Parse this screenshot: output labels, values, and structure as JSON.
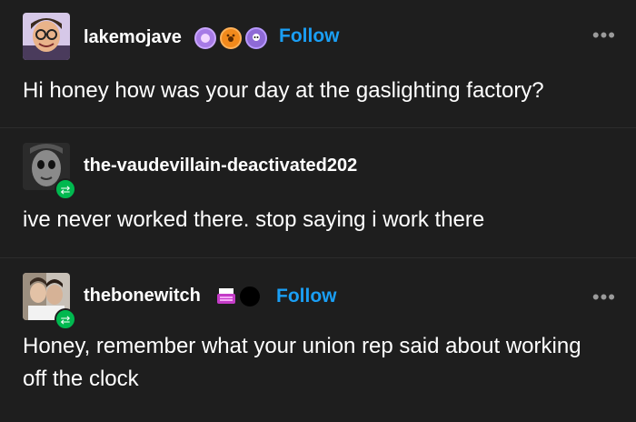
{
  "posts": [
    {
      "username": "lakemojave",
      "follow_label": "Follow",
      "more_label": "•••",
      "text": "Hi honey how was your day at the gaslighting factory?",
      "badges": [
        "blue-hand-badge",
        "orange-paw-badge",
        "purple-skull-badge"
      ]
    },
    {
      "username": "the-vaudevillain-deactivated202",
      "text": "ive never worked there. stop saying i work there",
      "reblog_icon": "reblog-icon"
    },
    {
      "username": "thebonewitch",
      "follow_label": "Follow",
      "more_label": "•••",
      "text": "Honey, remember what your union rep said about working off the clock",
      "badges": [
        "typewriter-badge",
        "black-circle-badge"
      ],
      "reblog_icon": "reblog-icon"
    }
  ],
  "colors": {
    "background": "#1e1e1e",
    "follow": "#1a9ff5",
    "reblog": "#00b84f",
    "more": "#9a9a9a"
  }
}
